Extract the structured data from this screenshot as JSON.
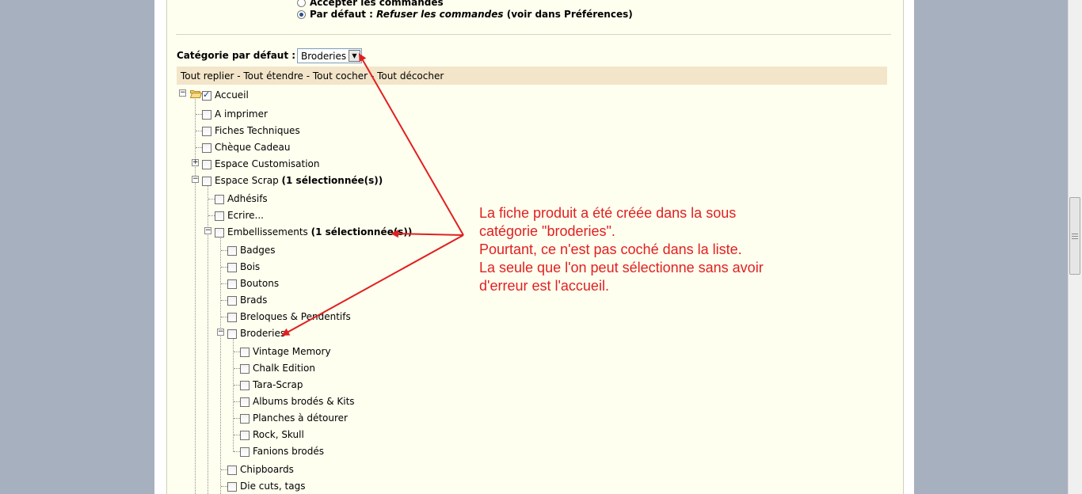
{
  "orders": {
    "accept_label": "Accepter les commandes",
    "default_prefix": "Par défaut : ",
    "default_value": "Refuser les commandes",
    "default_suffix": " (voir dans Préférences)"
  },
  "default_category": {
    "label": "Catégorie par défaut :",
    "selected": "Broderies"
  },
  "tree_toolbar": {
    "collapse_all": "Tout replier",
    "expand_all": "Tout étendre",
    "check_all": "Tout cocher",
    "uncheck_all": "Tout décocher",
    "separator": " - "
  },
  "tree": [
    {
      "label": "Accueil",
      "checked": true
    },
    {
      "label": "A imprimer"
    },
    {
      "label": "Fiches Techniques"
    },
    {
      "label": "Chèque Cadeau"
    },
    {
      "label": "Espace Customisation"
    },
    {
      "label": "Espace Scrap",
      "badge": "(1 sélectionnée(s))"
    },
    {
      "label": "Adhésifs"
    },
    {
      "label": "Ecrire..."
    },
    {
      "label": "Embellissements",
      "badge": "(1 sélectionnée(s))"
    },
    {
      "label": "Badges"
    },
    {
      "label": "Bois"
    },
    {
      "label": "Boutons"
    },
    {
      "label": "Brads"
    },
    {
      "label": "Breloques & Pendentifs"
    },
    {
      "label": "Broderies"
    },
    {
      "label": "Vintage Memory"
    },
    {
      "label": "Chalk Edition"
    },
    {
      "label": "Tara-Scrap"
    },
    {
      "label": "Albums brodés & Kits"
    },
    {
      "label": "Planches à détourer"
    },
    {
      "label": "Rock, Skull"
    },
    {
      "label": "Fanions brodés"
    },
    {
      "label": "Chipboards"
    },
    {
      "label": "Die cuts, tags"
    }
  ],
  "annotation": [
    "La fiche produit a été créée dans la sous",
    "catégorie \"broderies\".",
    "Pourtant, ce n'est pas coché dans la liste.",
    "La seule que l'on peut sélectionne sans avoir",
    "d'erreur est l'accueil."
  ],
  "colors": {
    "panel_bg": "#fffff0",
    "toolbar_bg": "#f3e5c9",
    "annotation": "#e02020",
    "page_bg": "#a7b0bf"
  }
}
